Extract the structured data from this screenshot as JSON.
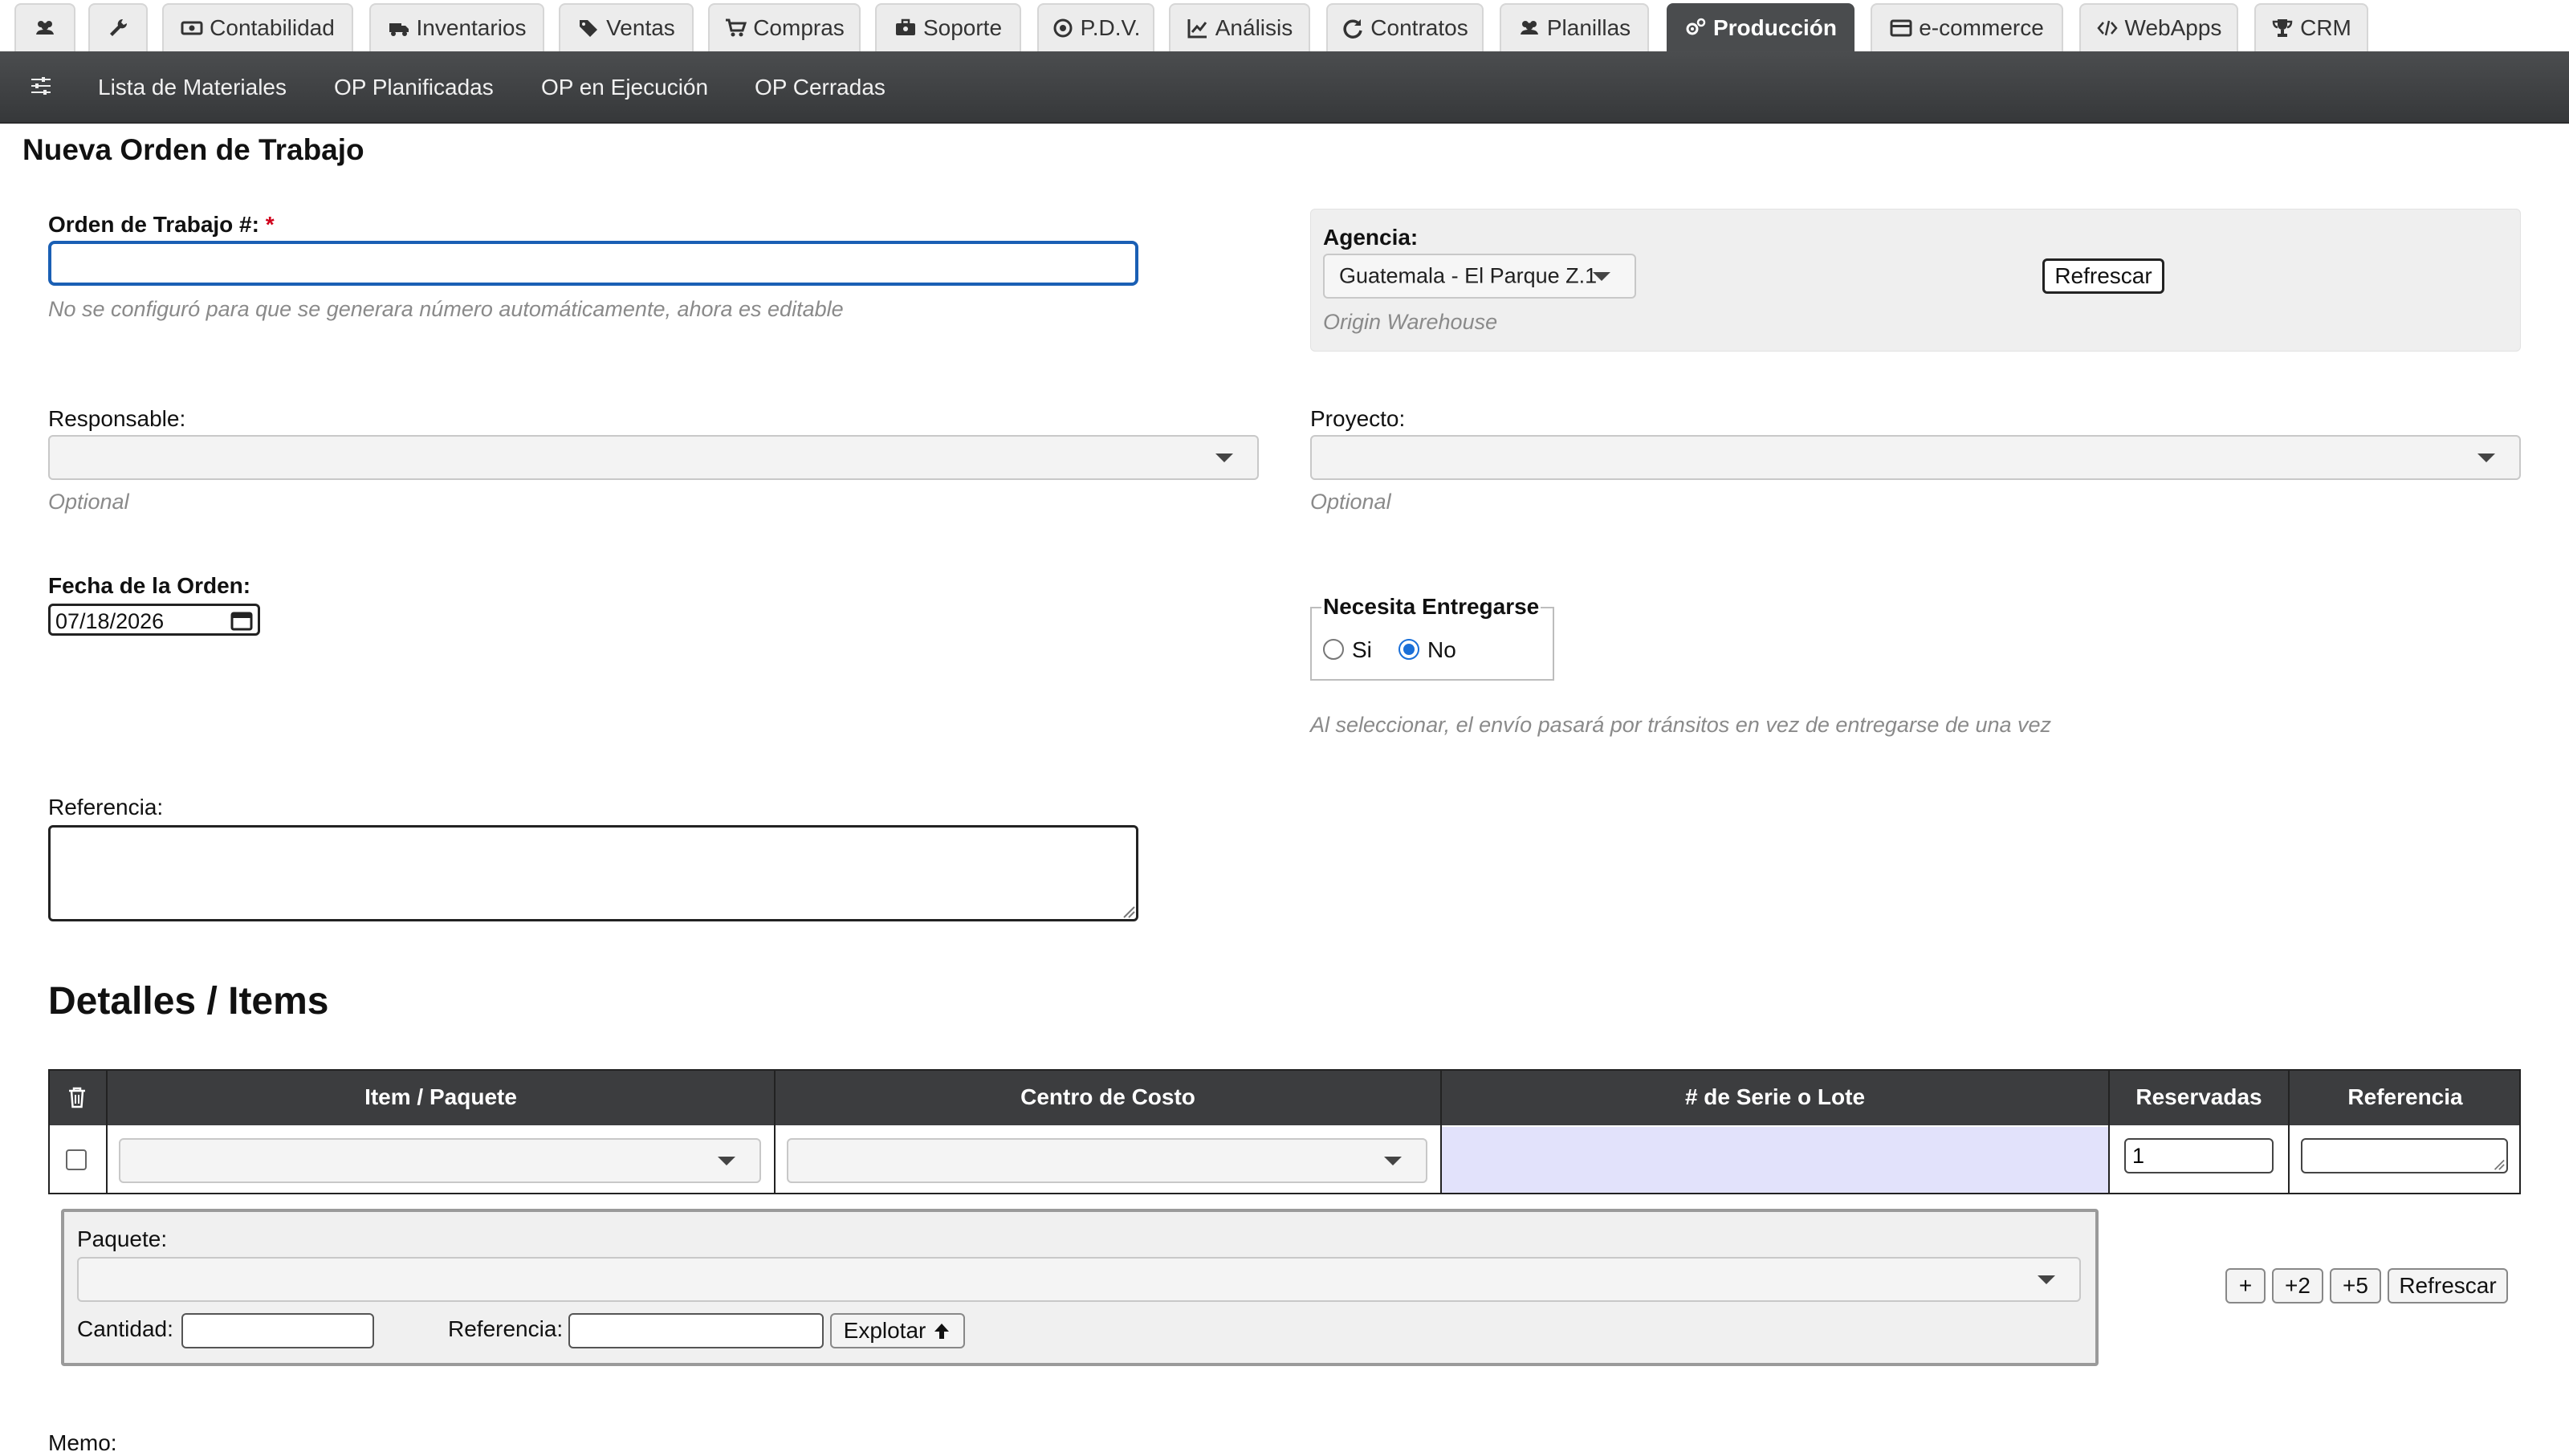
{
  "top_tabs": [
    {
      "id": "users",
      "label": "",
      "icon": "users-icon"
    },
    {
      "id": "tools",
      "label": "",
      "icon": "wrench-icon"
    },
    {
      "id": "contabilidad",
      "label": "Contabilidad",
      "icon": "money-icon"
    },
    {
      "id": "inventarios",
      "label": "Inventarios",
      "icon": "truck-icon"
    },
    {
      "id": "ventas",
      "label": "Ventas",
      "icon": "tags-icon"
    },
    {
      "id": "compras",
      "label": "Compras",
      "icon": "cart-icon"
    },
    {
      "id": "soporte",
      "label": "Soporte",
      "icon": "toolbox-icon"
    },
    {
      "id": "pdv",
      "label": "P.D.V.",
      "icon": "target-icon"
    },
    {
      "id": "analisis",
      "label": "Análisis",
      "icon": "line-chart-icon"
    },
    {
      "id": "contratos",
      "label": "Contratos",
      "icon": "refresh-icon"
    },
    {
      "id": "planillas",
      "label": "Planillas",
      "icon": "users-icon"
    },
    {
      "id": "produccion",
      "label": "Producción",
      "icon": "gears-icon",
      "active": true
    },
    {
      "id": "ecommerce",
      "label": "e-commerce",
      "icon": "credit-card-icon"
    },
    {
      "id": "webapps",
      "label": "WebApps",
      "icon": "code-icon"
    },
    {
      "id": "crm",
      "label": "CRM",
      "icon": "trophy-icon"
    }
  ],
  "subnav": [
    {
      "label": "Lista de Materiales"
    },
    {
      "label": "OP Planificadas"
    },
    {
      "label": "OP en Ejecución"
    },
    {
      "label": "OP Cerradas"
    }
  ],
  "page_title": "Nueva Orden de Trabajo",
  "form": {
    "orden": {
      "label": "Orden de Trabajo #:",
      "required_mark": "*",
      "value": "",
      "help": "No se configuró para que se generara número automáticamente, ahora es editable"
    },
    "agencia": {
      "label": "Agencia:",
      "value": "Guatemala - El Parque Z.1",
      "refresh_label": "Refrescar",
      "help": "Origin Warehouse"
    },
    "responsable": {
      "label": "Responsable:",
      "value": "",
      "help": "Optional"
    },
    "proyecto": {
      "label": "Proyecto:",
      "value": "",
      "help": "Optional"
    },
    "fecha": {
      "label": "Fecha de la Orden:",
      "value": "07/18/2026"
    },
    "entrega": {
      "legend": "Necesita Entregarse",
      "option_si": "Si",
      "option_no": "No",
      "selected": "No",
      "help": "Al seleccionar, el envío pasará por tránsitos en vez de entregarse de una vez"
    },
    "referencia": {
      "label": "Referencia:",
      "value": ""
    }
  },
  "items": {
    "title": "Detalles / Items",
    "columns": [
      "Item / Paquete",
      "Centro de Costo",
      "# de Serie o Lote",
      "Reservadas",
      "Referencia"
    ],
    "rows": [
      {
        "item": "",
        "centro_costo": "",
        "serie": "",
        "reservadas": "1",
        "referencia": ""
      }
    ],
    "package": {
      "paquete_label": "Paquete:",
      "cantidad_label": "Cantidad:",
      "referencia_label": "Referencia:",
      "explode_label": "Explotar"
    },
    "add_buttons": [
      "+",
      "+2",
      "+5"
    ],
    "refresh_label": "Refrescar"
  },
  "memo_label": "Memo:"
}
